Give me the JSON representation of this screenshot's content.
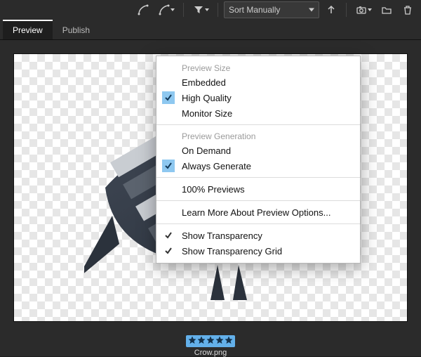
{
  "toolbar": {
    "sort_label": "Sort Manually"
  },
  "tabs": {
    "preview": "Preview",
    "publish": "Publish"
  },
  "menu": {
    "section_preview_size": "Preview Size",
    "embedded": "Embedded",
    "high_quality": "High Quality",
    "monitor_size": "Monitor Size",
    "section_preview_gen": "Preview Generation",
    "on_demand": "On Demand",
    "always_generate": "Always Generate",
    "hundred_previews": "100% Previews",
    "learn_more": "Learn More About Preview Options...",
    "show_transparency": "Show Transparency",
    "show_transparency_grid": "Show Transparency Grid"
  },
  "footer": {
    "rating": 5,
    "filename": "Crow.png"
  },
  "colors": {
    "accent_check": "#8ec8f0",
    "star_bg": "#63b0ea"
  }
}
